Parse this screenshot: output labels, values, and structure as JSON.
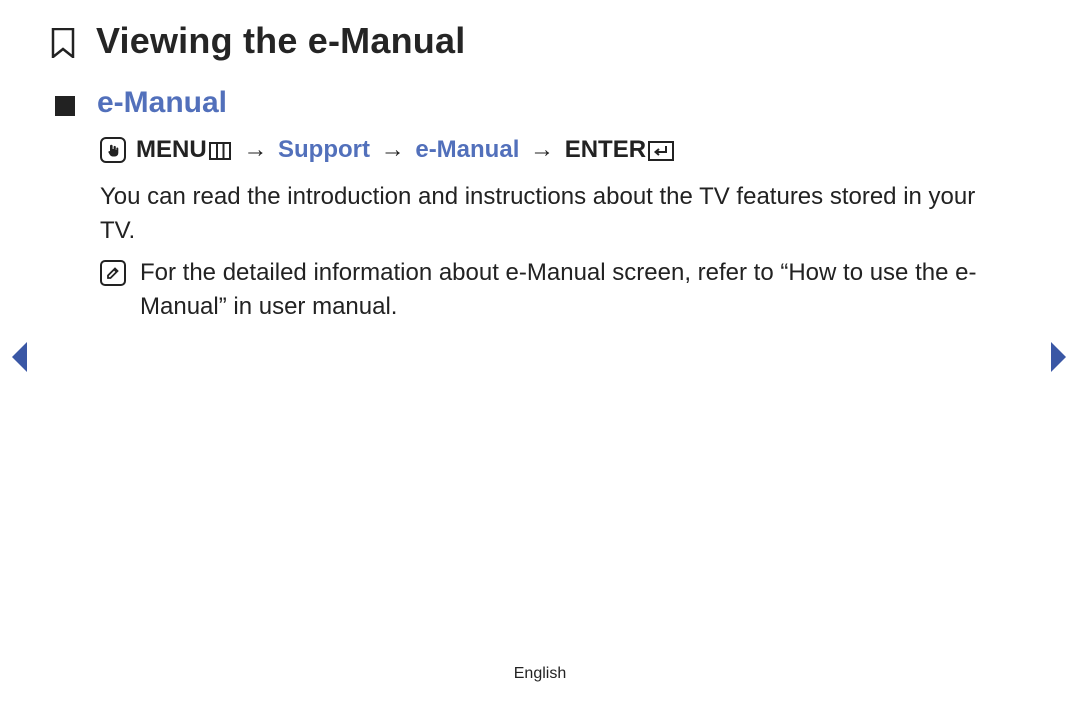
{
  "title": "Viewing the e-Manual",
  "section": {
    "heading": "e-Manual"
  },
  "menu_path": {
    "menu_label": "MENU",
    "arrow": "→",
    "support": "Support",
    "emanual": "e-Manual",
    "enter_label": "ENTER"
  },
  "body": "You can read the introduction and instructions about the TV features stored in your TV.",
  "note": "For the detailed information about e-Manual screen, refer to “How to use the e-Manual” in user manual.",
  "footer": {
    "language": "English"
  },
  "colors": {
    "accent": "#5270bb",
    "nav_arrow": "#3a57a5"
  }
}
